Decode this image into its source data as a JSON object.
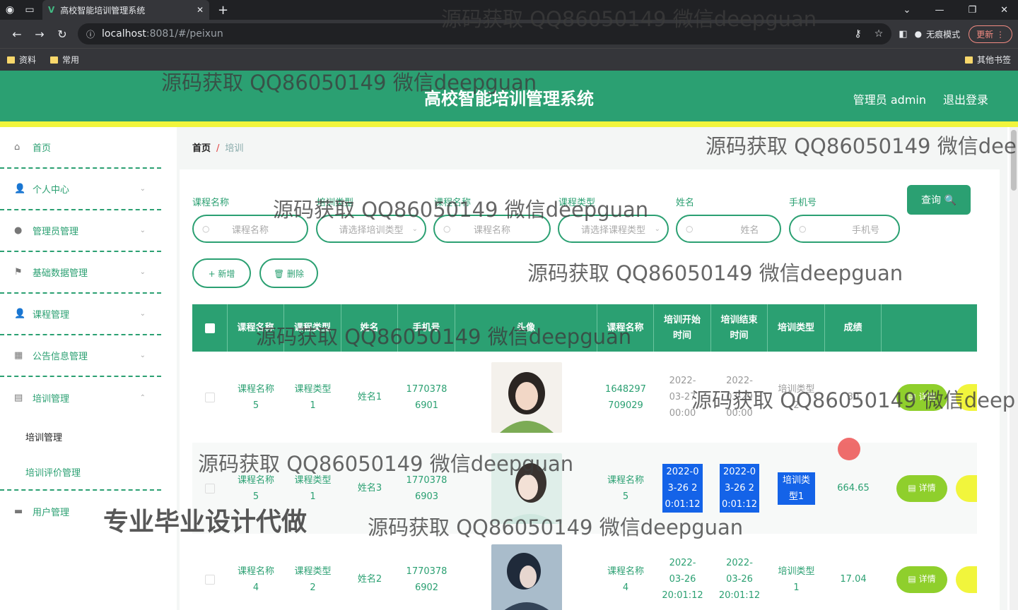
{
  "browser": {
    "tab_title": "高校智能培训管理系统",
    "url_host": "localhost",
    "url_path": ":8081/#/peixun",
    "incognito_label": "无痕模式",
    "update_label": "更新",
    "bookmarks": [
      "资料",
      "常用"
    ],
    "other_bookmarks": "其他书签"
  },
  "header": {
    "title": "高校智能培训管理系统",
    "user": "管理员 admin",
    "logout": "退出登录"
  },
  "sidebar": {
    "items": [
      {
        "label": "首页",
        "icon": "home-icon"
      },
      {
        "label": "个人中心",
        "icon": "person-icon"
      },
      {
        "label": "管理员管理",
        "icon": "bulb-icon"
      },
      {
        "label": "基础数据管理",
        "icon": "flag-icon"
      },
      {
        "label": "课程管理",
        "icon": "user-icon"
      },
      {
        "label": "公告信息管理",
        "icon": "grid-icon"
      },
      {
        "label": "培训管理",
        "icon": "chart-icon"
      }
    ],
    "subitems": [
      "培训管理",
      "培训评价管理"
    ],
    "last_item": "用户管理"
  },
  "breadcrumb": {
    "home": "首页",
    "sep": "/",
    "current": "培训"
  },
  "filters": {
    "labels": [
      "课程名称",
      "培训类型",
      "课程名称",
      "课程类型",
      "姓名",
      "手机号"
    ],
    "placeholders": [
      "课程名称",
      "请选择培训类型",
      "课程名称",
      "请选择课程类型",
      "姓名",
      "手机号"
    ]
  },
  "buttons": {
    "query": "查询 🔍",
    "add": "+ 新增",
    "delete": "🗑 删除",
    "detail": "▤ 详情"
  },
  "table": {
    "headers": [
      "课程名称",
      "课程类型",
      "姓名",
      "手机号",
      "头像",
      "课程名称",
      "培训开始时间",
      "培训结束时间",
      "培训类型",
      "成绩"
    ],
    "rows": [
      {
        "course": "课程名称5",
        "ctype": "课程类型1",
        "name": "姓名1",
        "phone": "17703786901",
        "course2": "1648297709029",
        "start": "2022-03-27 00:00",
        "end": "2022-03-29 00:00",
        "ttype": "培训类型2",
        "score": "30"
      },
      {
        "course": "课程名称5",
        "ctype": "课程类型1",
        "name": "姓名3",
        "phone": "17703786903",
        "course2": "课程名称5",
        "start": "2022-03-26 20:01:12",
        "end": "2022-03-26 20:01:12",
        "ttype": "培训类型1",
        "score": "664.65"
      },
      {
        "course": "课程名称4",
        "ctype": "课程类型2",
        "name": "姓名2",
        "phone": "17703786902",
        "course2": "课程名称4",
        "start": "2022-03-26 20:01:12",
        "end": "2022-03-26 20:01:12",
        "ttype": "培训类型1",
        "score": "17.04"
      }
    ]
  },
  "watermarks": {
    "text": "源码获取 QQ86050149 微信deepguan",
    "text_cut": "源码获取 QQ86050149 微信dee",
    "text_cut2": "源码获取 QQ86050149 微信deep",
    "bold": "专业毕业设计代做"
  },
  "colors": {
    "primary": "#2ba072",
    "accent_yellow": "#f1f53c",
    "detail_green": "#8fcf2c"
  }
}
